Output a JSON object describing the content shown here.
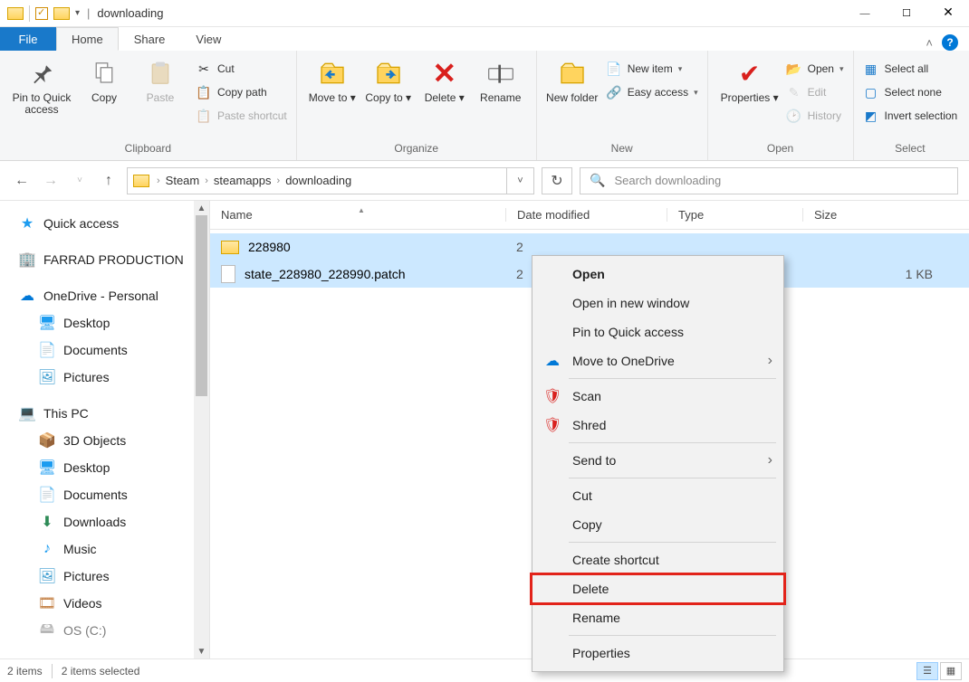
{
  "window": {
    "title": "downloading"
  },
  "tabs": {
    "file": "File",
    "home": "Home",
    "share": "Share",
    "view": "View"
  },
  "ribbon": {
    "clipboard": {
      "label": "Clipboard",
      "pin": "Pin to Quick access",
      "copy": "Copy",
      "paste": "Paste",
      "cut": "Cut",
      "copy_path": "Copy path",
      "paste_shortcut": "Paste shortcut"
    },
    "organize": {
      "label": "Organize",
      "move_to": "Move to",
      "copy_to": "Copy to",
      "delete": "Delete",
      "rename": "Rename"
    },
    "new": {
      "label": "New",
      "new_folder": "New folder",
      "new_item": "New item",
      "easy_access": "Easy access"
    },
    "open": {
      "label": "Open",
      "properties": "Properties",
      "open": "Open",
      "edit": "Edit",
      "history": "History"
    },
    "select": {
      "label": "Select",
      "select_all": "Select all",
      "select_none": "Select none",
      "invert": "Invert selection"
    }
  },
  "breadcrumb": [
    "Steam",
    "steamapps",
    "downloading"
  ],
  "search_placeholder": "Search downloading",
  "columns": {
    "name": "Name",
    "date": "Date modified",
    "type": "Type",
    "size": "Size"
  },
  "files": [
    {
      "name": "228980",
      "kind": "folder",
      "date": "2",
      "size": ""
    },
    {
      "name": "state_228980_228990.patch",
      "kind": "file",
      "date": "2",
      "size": "1 KB"
    }
  ],
  "sidebar": {
    "quick_access": "Quick access",
    "farrad": "FARRAD PRODUCTION",
    "onedrive": "OneDrive - Personal",
    "desktop": "Desktop",
    "documents": "Documents",
    "pictures": "Pictures",
    "this_pc": "This PC",
    "objects3d": "3D Objects",
    "desktop2": "Desktop",
    "documents2": "Documents",
    "downloads": "Downloads",
    "music": "Music",
    "pictures2": "Pictures",
    "videos": "Videos",
    "os_c": "OS (C:)"
  },
  "context": {
    "open": "Open",
    "open_new": "Open in new window",
    "pin_quick": "Pin to Quick access",
    "move_onedrive": "Move to OneDrive",
    "scan": "Scan",
    "shred": "Shred",
    "send_to": "Send to",
    "cut": "Cut",
    "copy": "Copy",
    "create_shortcut": "Create shortcut",
    "delete": "Delete",
    "rename": "Rename",
    "properties": "Properties"
  },
  "status": {
    "items": "2 items",
    "selected": "2 items selected"
  }
}
